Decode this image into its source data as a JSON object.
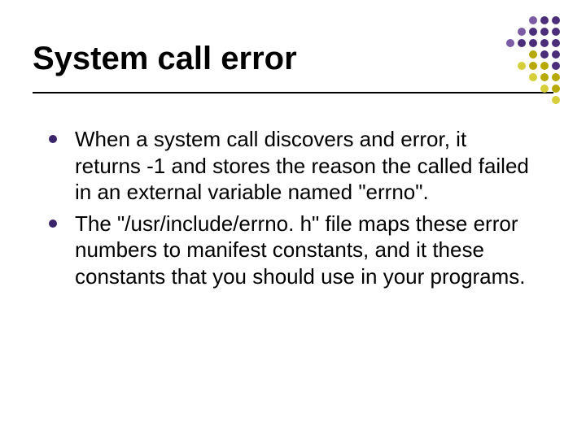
{
  "title": "System call error",
  "bullets": [
    "When a system call discovers and error, it returns -1 and stores the reason the called failed in an external variable named \"errno\".",
    "The \"/usr/include/errno. h\" file maps these error numbers to manifest constants, and it these constants that you should use in your programs."
  ],
  "corner_dots": [
    [
      "c0",
      "c0",
      "c0",
      "c1",
      "c2",
      "c2"
    ],
    [
      "c0",
      "c0",
      "c1",
      "c2",
      "c2",
      "c2"
    ],
    [
      "c0",
      "c1",
      "c2",
      "c2",
      "c2",
      "c2"
    ],
    [
      "c0",
      "c0",
      "c0",
      "c3",
      "c2",
      "c2"
    ],
    [
      "c0",
      "c0",
      "c4",
      "c3",
      "c3",
      "c2"
    ],
    [
      "c0",
      "c0",
      "c0",
      "c4",
      "c3",
      "c3"
    ],
    [
      "c0",
      "c0",
      "c0",
      "c0",
      "c4",
      "c3"
    ],
    [
      "c0",
      "c0",
      "c0",
      "c0",
      "c0",
      "c4"
    ]
  ]
}
